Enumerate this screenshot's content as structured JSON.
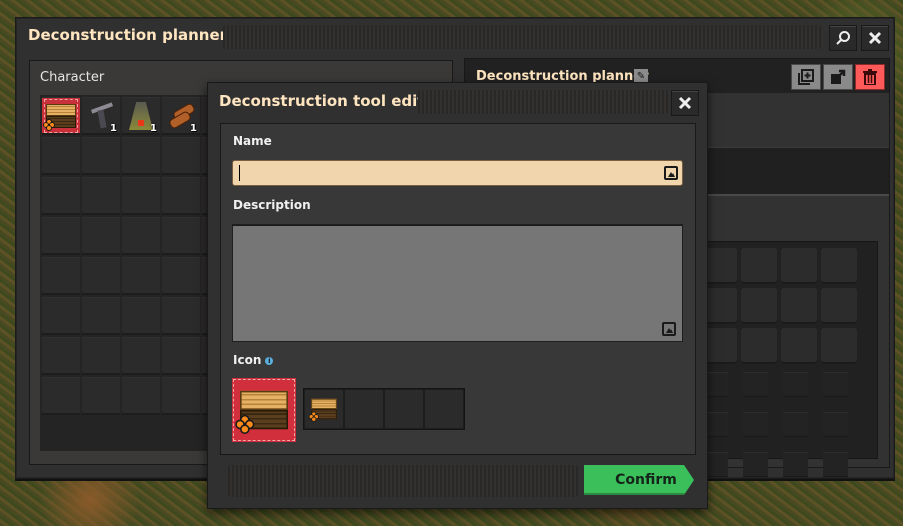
{
  "main_window": {
    "title": "Deconstruction planner",
    "search_icon": "magnifier-icon",
    "close_icon": "close-icon"
  },
  "character_panel": {
    "label": "Character",
    "slots": [
      {
        "item": "deconstruction-planner",
        "count": "",
        "selected": true
      },
      {
        "item": "submachine-gun",
        "count": "1"
      },
      {
        "item": "light-armor",
        "count": "1"
      },
      {
        "item": "wood",
        "count": "1"
      }
    ]
  },
  "library_panel": {
    "title": "Deconstruction planner",
    "rename_icon": "pencil-icon",
    "buttons": [
      {
        "name": "copy",
        "icon": "copy-plus-icon"
      },
      {
        "name": "export",
        "icon": "export-arrow-icon"
      },
      {
        "name": "delete",
        "icon": "trash-icon",
        "color": "#fe5a5a"
      }
    ]
  },
  "dialog": {
    "title": "Deconstruction tool edit",
    "name_label": "Name",
    "name_value": "",
    "description_label": "Description",
    "description_value": "",
    "icon_label": "Icon",
    "icon_info": "i",
    "confirm_label": "Confirm",
    "confirm_color": "#3bbf5a",
    "selected_icon": "deconstruction-planner",
    "icon_slots": [
      "deconstruction-planner",
      "",
      "",
      ""
    ]
  }
}
